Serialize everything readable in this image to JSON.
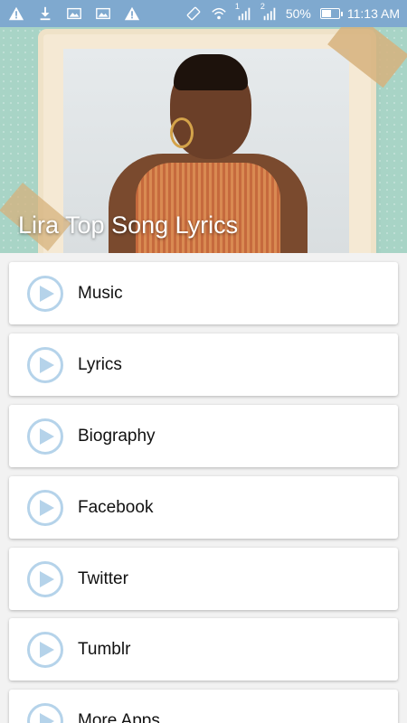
{
  "status_bar": {
    "battery": "50%",
    "time": "11:13 AM",
    "sim1": "1",
    "sim2": "2",
    "icons": [
      "warning-icon",
      "download-icon",
      "image-icon",
      "image-icon",
      "warning-icon",
      "vibrate-icon",
      "wifi-icon",
      "signal-icon",
      "signal-icon",
      "battery-icon"
    ],
    "color": "#7fa9cf"
  },
  "header": {
    "title": "Lira Top Song Lyrics"
  },
  "menu": {
    "items": [
      {
        "label": "Music"
      },
      {
        "label": "Lyrics"
      },
      {
        "label": "Biography"
      },
      {
        "label": "Facebook"
      },
      {
        "label": "Twitter"
      },
      {
        "label": "Tumblr"
      },
      {
        "label": "More Apps"
      }
    ],
    "icon": "play-circle-icon",
    "accent": "#b5d3ea"
  }
}
